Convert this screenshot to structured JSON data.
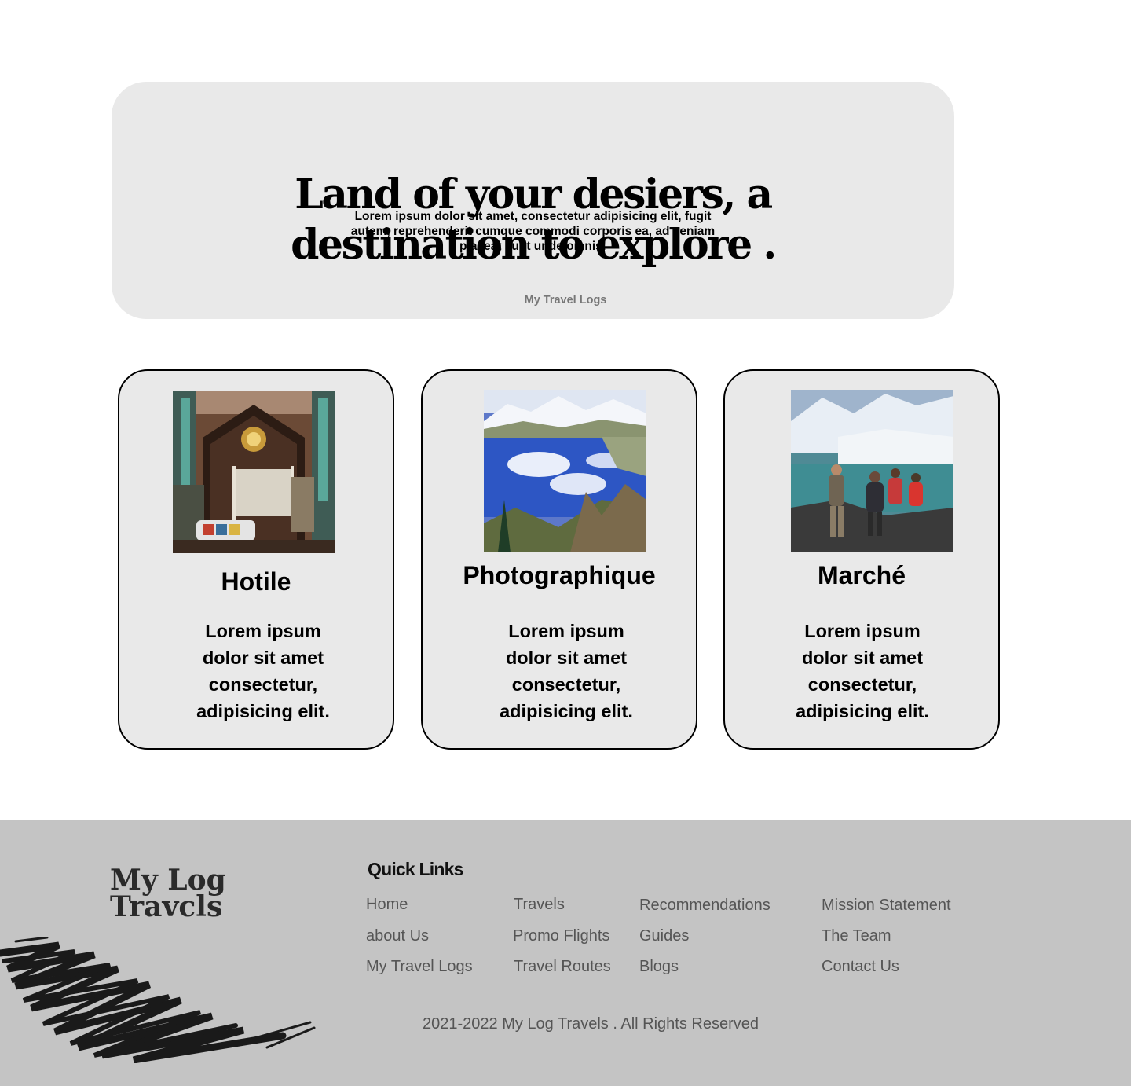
{
  "hero": {
    "title_line1": "Land of your desiers, a",
    "title_line2": "destination to explore .",
    "text": "Lorem ipsum dolor sit amet, consectetur adipisicing elit, fugit autem, reprehenderit cumque commodi corporis ea, ad veniam placeat sunt unde omnis!",
    "link": "My Travel Logs",
    "background": "#e9e9e9"
  },
  "cards": [
    {
      "title": "Hotile",
      "text": "Lorem ipsum dolor sit amet consectetur, adipisicing elit."
    },
    {
      "title": "Photographique",
      "text": "Lorem ipsum dolor sit amet consectetur, adipisicing elit."
    },
    {
      "title": "Marché",
      "text": "Lorem ipsum dolor sit amet consectetur, adipisicing elit."
    }
  ],
  "footer": {
    "logo_line1": "My Log",
    "logo_line2": "Travcls",
    "quick_links_title": "Quick Links",
    "links": [
      [
        "Home",
        "about Us",
        "My Travel Logs"
      ],
      [
        "Travels",
        "Promo Flights",
        "Travel Routes"
      ],
      [
        "Recommendations",
        "Guides",
        "Blogs"
      ],
      [
        "Mission Statement",
        "The Team",
        "Contact Us"
      ]
    ],
    "copyright": "2021-2022 My Log Travels . All Rights Reserved",
    "background": "#c4c4c4"
  }
}
